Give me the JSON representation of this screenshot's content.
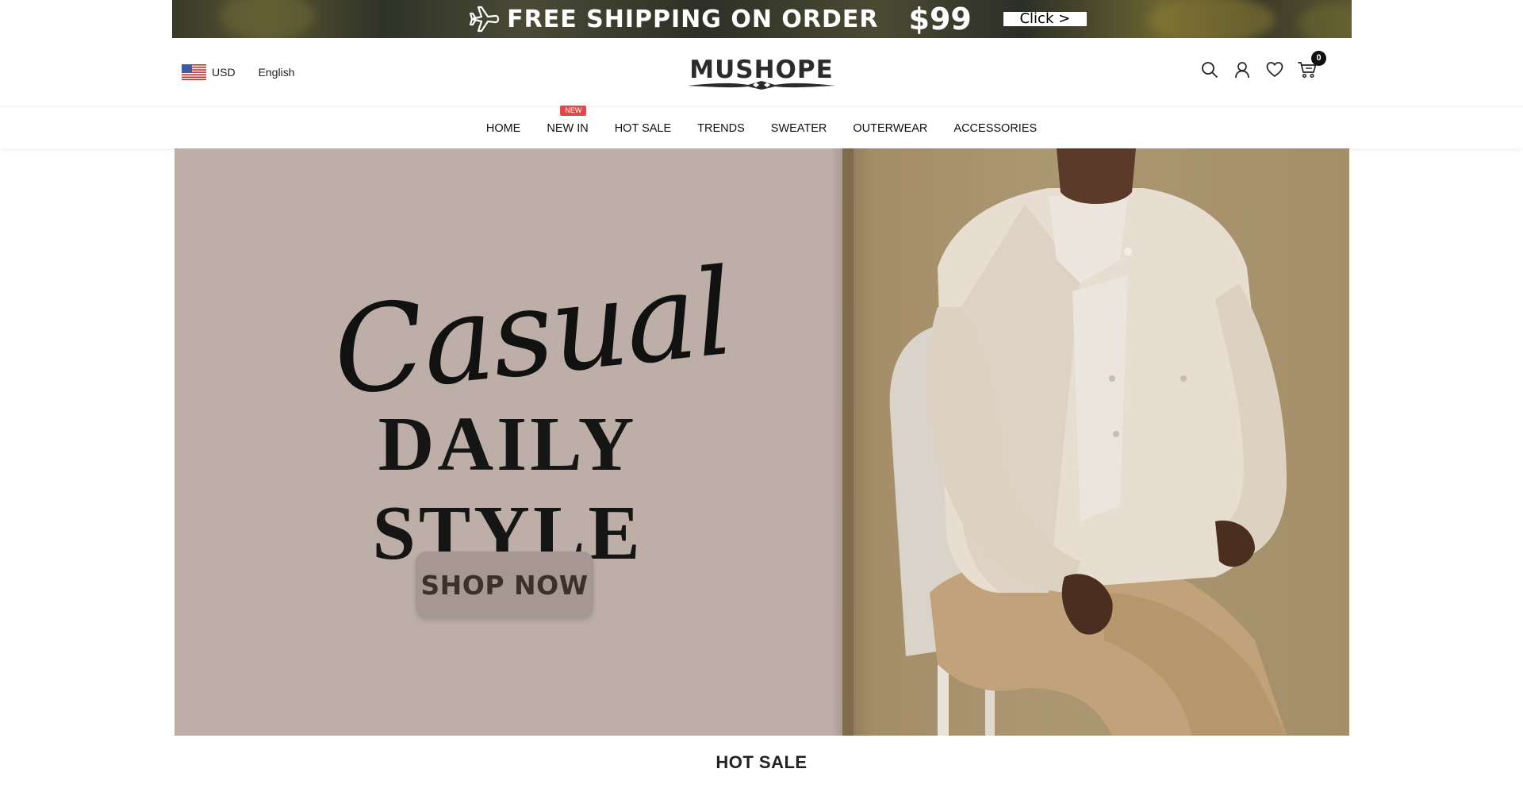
{
  "promo": {
    "text": "FREE SHIPPING ON ORDER",
    "price": "$99",
    "cta": "Click >"
  },
  "header": {
    "currency": "USD",
    "language": "English",
    "logo_text": "MUSHOPE",
    "cart_count": "0"
  },
  "nav": {
    "items": [
      {
        "label": "HOME"
      },
      {
        "label": "NEW IN",
        "badge": "New"
      },
      {
        "label": "HOT SALE"
      },
      {
        "label": "TRENDS"
      },
      {
        "label": "SWEATER"
      },
      {
        "label": "OUTERWEAR"
      },
      {
        "label": "ACCESSORIES"
      }
    ]
  },
  "hero": {
    "script_title": "Casual",
    "title": "DAILY STYLE",
    "cta": "SHOP NOW"
  },
  "section": {
    "title": "HOT SALE"
  },
  "colors": {
    "hero_left_bg": "#bdaea8",
    "hero_right_bg": "#ac9773",
    "nav_badge": "#e04a4a",
    "shop_now_bg": "#a69793"
  }
}
